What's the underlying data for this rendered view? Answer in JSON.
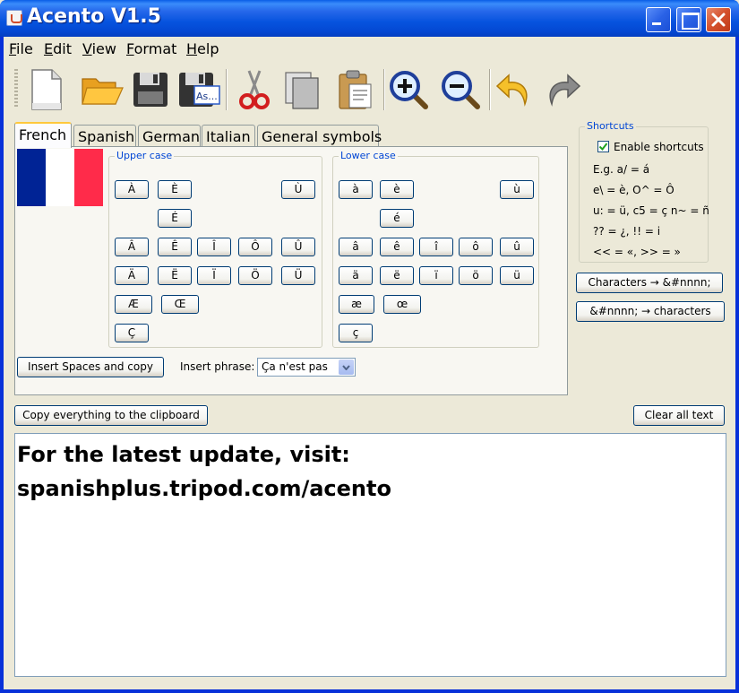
{
  "window": {
    "title": "Acento V1.5"
  },
  "menu": {
    "items": [
      {
        "mnemonic": "F",
        "rest": "ile"
      },
      {
        "mnemonic": "E",
        "rest": "dit"
      },
      {
        "mnemonic": "V",
        "rest": "iew"
      },
      {
        "mnemonic": "F",
        "rest": "ormat"
      },
      {
        "mnemonic": "H",
        "rest": "elp"
      }
    ]
  },
  "toolbar": {
    "buttons": [
      "new-file-icon",
      "open-folder-icon",
      "save-icon",
      "save-as-icon",
      "cut-icon",
      "copy-icon",
      "paste-icon",
      "zoom-in-icon",
      "zoom-out-icon",
      "undo-icon",
      "redo-icon"
    ],
    "save_as_badge": "As..."
  },
  "tabs": [
    "French",
    "Spanish",
    "German",
    "Italian",
    "General symbols"
  ],
  "flag_colors": [
    "#002395",
    "#ffffff",
    "#ff2b4a"
  ],
  "french": {
    "upper_title": "Upper case",
    "lower_title": "Lower case",
    "upper_keys": {
      "grave": [
        "À",
        "È",
        "Ù"
      ],
      "acute": [
        "É"
      ],
      "circ": [
        "Â",
        "Ê",
        "Î",
        "Ô",
        "Û"
      ],
      "uml": [
        "Ä",
        "Ë",
        "Ï",
        "Ö",
        "Ü"
      ],
      "lig": [
        "Æ",
        "Œ"
      ],
      "ced": [
        "Ç"
      ]
    },
    "lower_keys": {
      "grave": [
        "à",
        "è",
        "ù"
      ],
      "acute": [
        "é"
      ],
      "circ": [
        "â",
        "ê",
        "î",
        "ô",
        "û"
      ],
      "uml": [
        "ä",
        "ë",
        "ï",
        "ö",
        "ü"
      ],
      "lig": [
        "æ",
        "œ"
      ],
      "ced": [
        "ç"
      ]
    },
    "insert_spaces_label": "Insert Spaces and copy",
    "insert_phrase_label": "Insert phrase:",
    "insert_phrase_value": "Ça n'est pas"
  },
  "shortcuts": {
    "title": "Shortcuts",
    "enable_label": "Enable shortcuts",
    "enabled": true,
    "lines": [
      "E.g. a/ = á",
      "e\\ = è, O^ = Ô",
      "u: = ü, c5 = ç n~ = ñ",
      "?? = ¿, !! = i",
      "<< = «, >> = »"
    ]
  },
  "convert": {
    "to_entities": "Characters → &#nnnn;",
    "to_chars": "&#nnnn; → characters"
  },
  "actions": {
    "copy_all": "Copy everything to the clipboard",
    "clear_all": "Clear all text"
  },
  "editor": {
    "lines": [
      "For the latest update, visit:",
      "spanishplus.tripod.com/acento"
    ]
  }
}
